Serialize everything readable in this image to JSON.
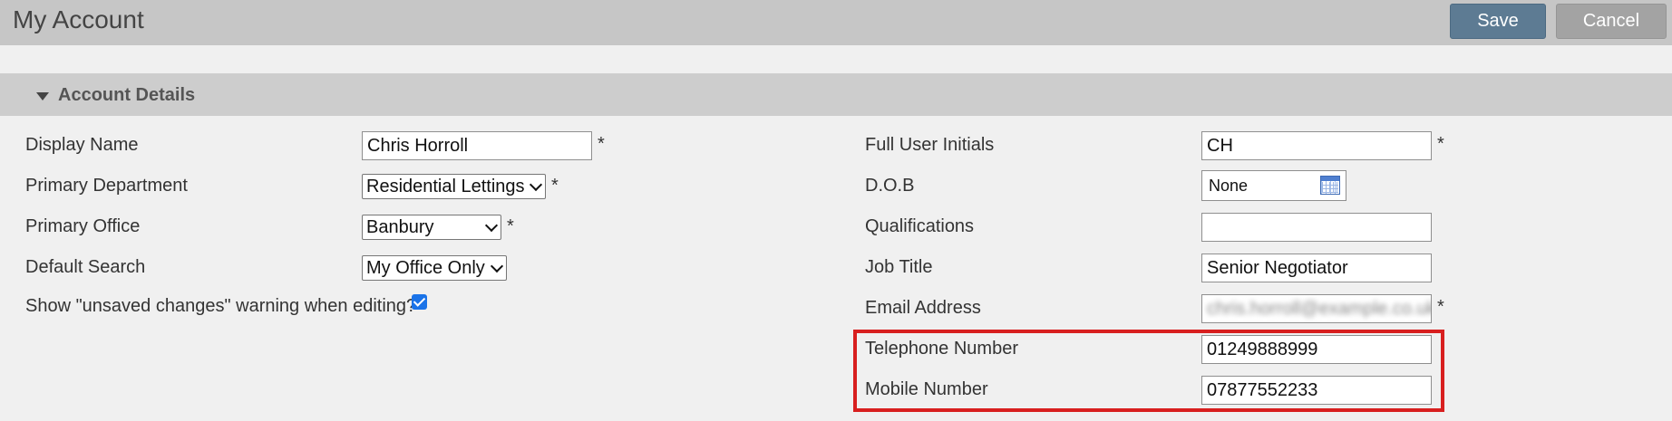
{
  "header": {
    "title": "My Account",
    "save_label": "Save",
    "cancel_label": "Cancel"
  },
  "section": {
    "title": "Account Details"
  },
  "left_fields": {
    "display_name": {
      "label": "Display Name",
      "value": "Chris Horroll",
      "required": "*"
    },
    "primary_department": {
      "label": "Primary Department",
      "value": "Residential Lettings",
      "required": "*"
    },
    "primary_office": {
      "label": "Primary Office",
      "value": "Banbury",
      "required": "*"
    },
    "default_search": {
      "label": "Default Search",
      "value": "My Office Only"
    },
    "unsaved_warning": {
      "label": "Show \"unsaved changes\" warning when editing?",
      "checked": true
    }
  },
  "right_fields": {
    "full_user_initials": {
      "label": "Full User Initials",
      "value": "CH",
      "required": "*"
    },
    "dob": {
      "label": "D.O.B",
      "value": "None"
    },
    "qualifications": {
      "label": "Qualifications",
      "value": ""
    },
    "job_title": {
      "label": "Job Title",
      "value": "Senior Negotiator"
    },
    "email_address": {
      "label": "Email Address",
      "value": "chris.horroll@example.co.uk",
      "required": "*"
    },
    "telephone_number": {
      "label": "Telephone Number",
      "value": "01249888999"
    },
    "mobile_number": {
      "label": "Mobile Number",
      "value": "07877552233"
    }
  },
  "colors": {
    "save_button": "#5d7b93",
    "cancel_button": "#a3a3a3",
    "highlight": "#d81f1f",
    "checkbox": "#1a73e8"
  },
  "icons": {
    "section_toggle": "caret-down-icon",
    "date_picker": "calendar-icon"
  }
}
